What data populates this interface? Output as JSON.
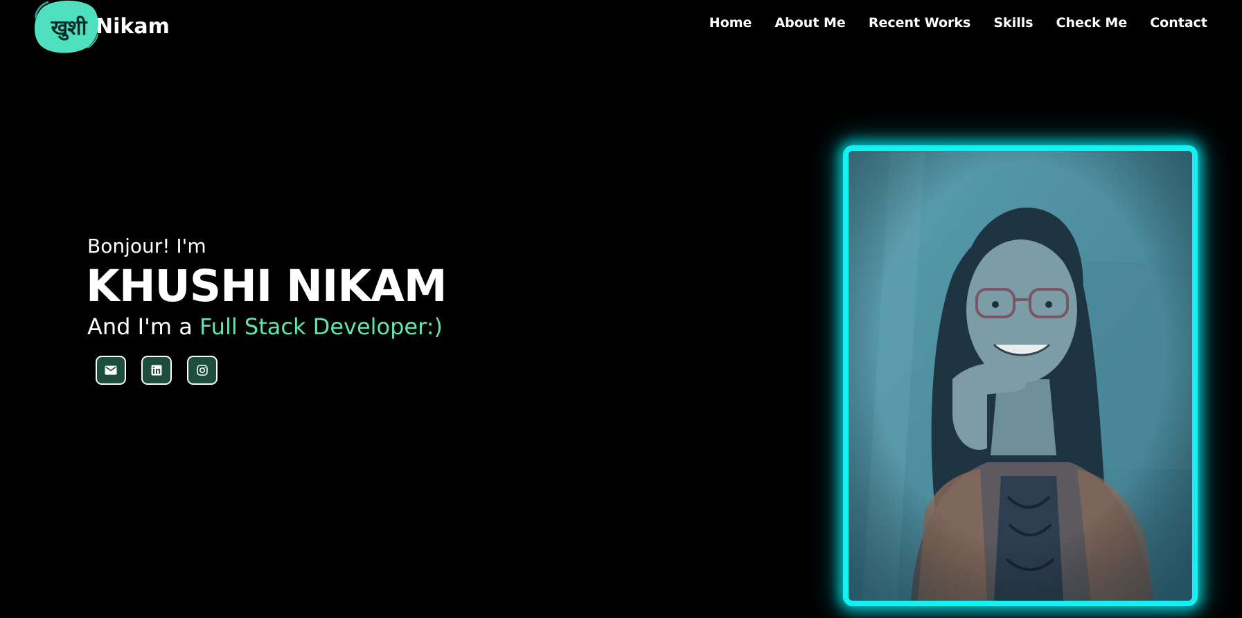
{
  "logo": {
    "hindi_text": "खुशी",
    "text": "Nikam",
    "accent_color": "#4fe0c0"
  },
  "nav": {
    "items": [
      {
        "label": "Home"
      },
      {
        "label": "About Me"
      },
      {
        "label": "Recent Works"
      },
      {
        "label": "Skills"
      },
      {
        "label": "Check Me"
      },
      {
        "label": "Contact"
      }
    ]
  },
  "hero": {
    "greeting": "Bonjour! I'm",
    "name": "KHUSHI NIKAM",
    "role_prefix": "And I'm a ",
    "role": "Full Stack Developer:)",
    "role_color": "#5fe6b5",
    "socials": [
      {
        "icon": "mail-icon"
      },
      {
        "icon": "linkedin-icon"
      },
      {
        "icon": "instagram-icon"
      }
    ]
  },
  "portrait": {
    "frame_color": "#12f2f2",
    "description_icon": "profile-photo"
  }
}
